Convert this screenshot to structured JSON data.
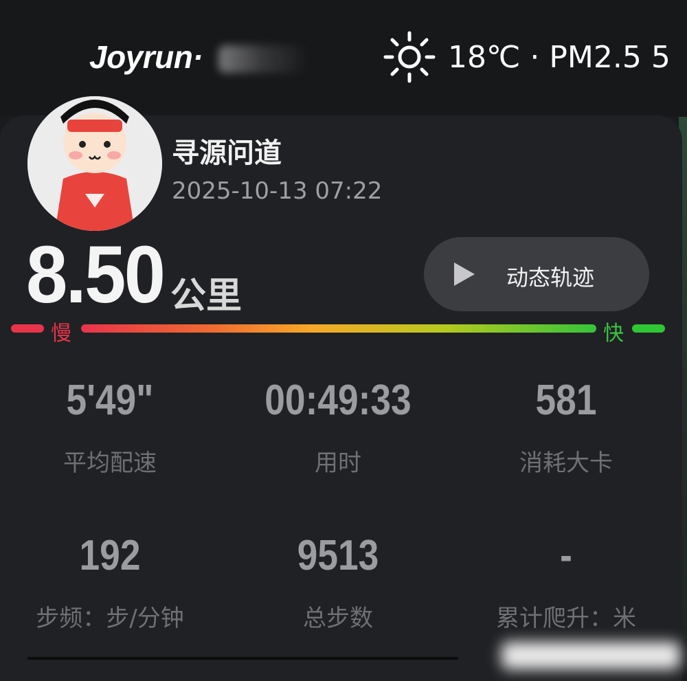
{
  "header": {
    "brand": "Joyrun·",
    "weather_icon": "sun-icon",
    "weather_text": "18℃ · PM2.5 5"
  },
  "profile": {
    "username": "寻源问道",
    "datetime": "2025-10-13 07:22"
  },
  "run": {
    "distance": "8.50",
    "distance_unit": "公里",
    "track_button_label": "动态轨迹"
  },
  "pace_legend": {
    "slow": "慢",
    "fast": "快",
    "colors": [
      "#e8344a",
      "#f7a928",
      "#35c33a"
    ]
  },
  "stats": [
    {
      "value": "5'49\"",
      "label": "平均配速"
    },
    {
      "value": "00:49:33",
      "label": "用时"
    },
    {
      "value": "581",
      "label": "消耗大卡"
    },
    {
      "value": "192",
      "label": "步频：步/分钟"
    },
    {
      "value": "9513",
      "label": "总步数"
    },
    {
      "value": "-",
      "label": "累计爬升：米"
    }
  ]
}
